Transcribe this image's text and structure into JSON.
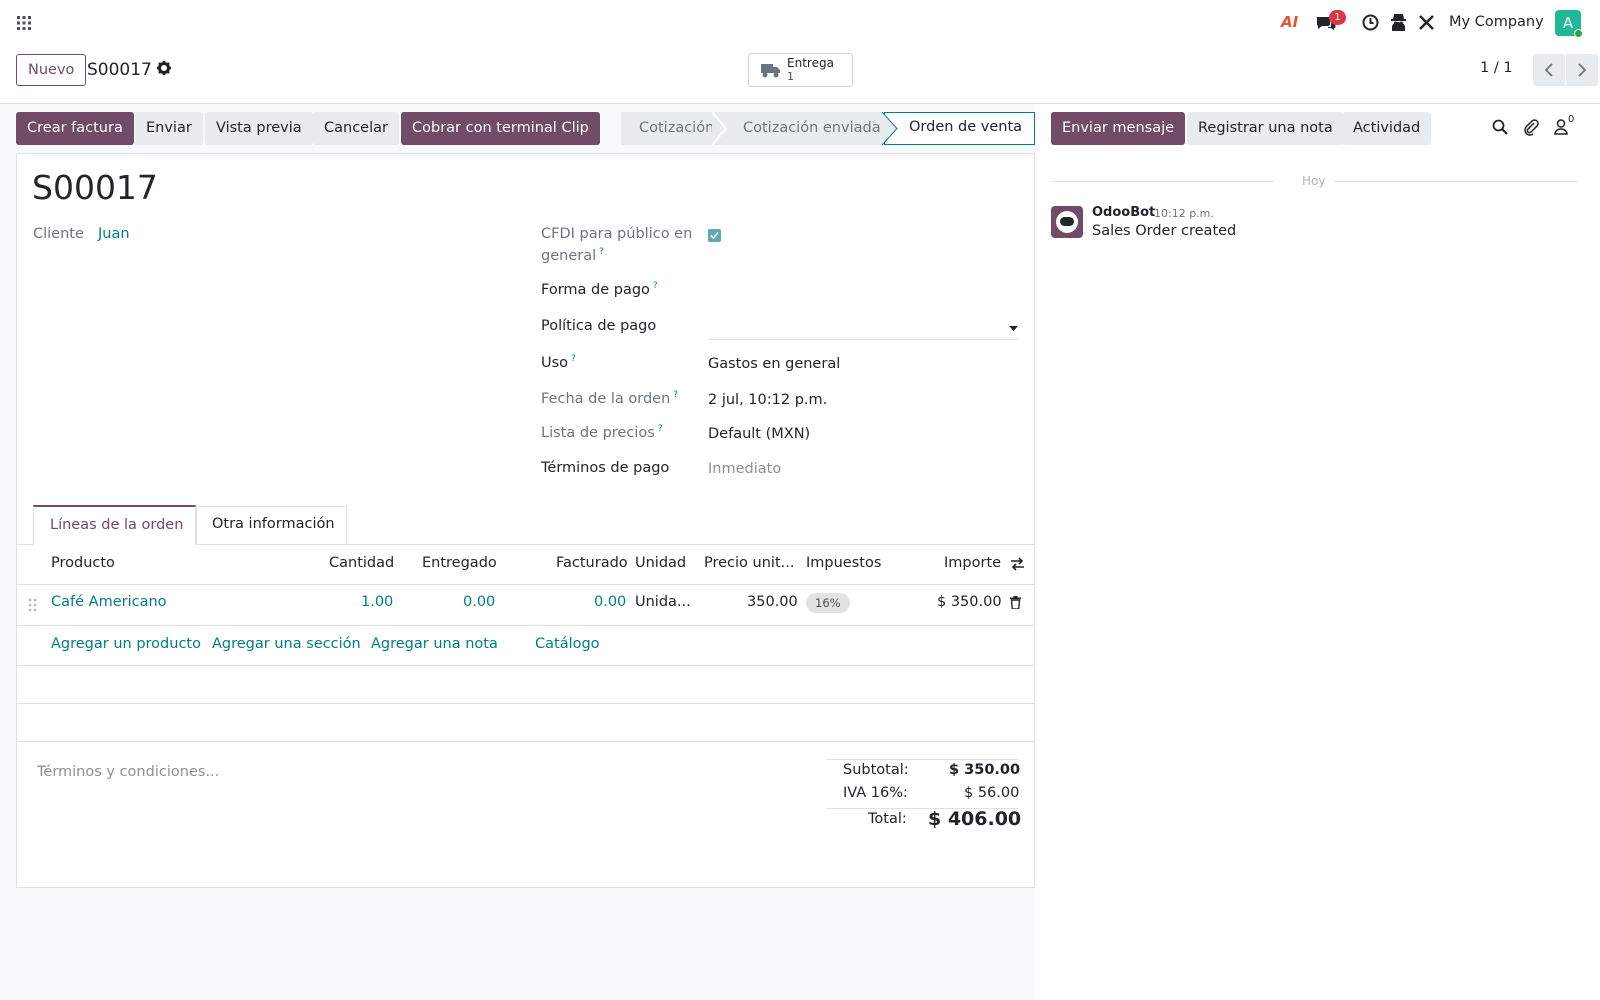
{
  "topbar": {
    "company": "My Company",
    "notif_count": "1",
    "avatar_letter": "A",
    "ai_label": "AI"
  },
  "control": {
    "new_label": "Nuevo",
    "record": "S00017",
    "delivery_label": "Entrega",
    "delivery_count": "1",
    "pager": "1 / 1"
  },
  "actions": {
    "create_invoice": "Crear factura",
    "send": "Enviar",
    "preview": "Vista previa",
    "cancel": "Cancelar",
    "clip": "Cobrar con terminal Clip"
  },
  "stages": [
    "Cotización",
    "Cotización enviada",
    "Orden de venta"
  ],
  "chatter": {
    "send_message": "Enviar mensaje",
    "log_note": "Registrar una nota",
    "activity": "Actividad",
    "followers_count": "0",
    "today": "Hoy",
    "author": "OdooBot",
    "time": "10:12 p.m.",
    "message": "Sales Order created"
  },
  "form": {
    "title": "S00017",
    "customer_label": "Cliente",
    "customer_value": "Juan",
    "cfdi_label_1": "CFDI para público en",
    "cfdi_label_2": "general",
    "forma_pago_label": "Forma de pago",
    "politica_label": "Política de pago",
    "uso_label": "Uso",
    "uso_value": "Gastos en general",
    "fecha_label": "Fecha de la orden",
    "fecha_value": "2 jul, 10:12 p.m.",
    "lista_label": "Lista de precios",
    "lista_value": "Default (MXN)",
    "terminos_label": "Términos de pago",
    "terminos_placeholder": "Inmediato",
    "help": "?"
  },
  "tabs": [
    "Líneas de la orden",
    "Otra información"
  ],
  "table": {
    "headers": {
      "product": "Producto",
      "qty": "Cantidad",
      "delivered": "Entregado",
      "invoiced": "Facturado",
      "unit": "Unidad",
      "price": "Precio unit...",
      "taxes": "Impuestos",
      "amount": "Importe"
    },
    "rows": [
      {
        "product": "Café Americano",
        "qty": "1.00",
        "delivered": "0.00",
        "invoiced": "0.00",
        "unit": "Unida...",
        "price": "350.00",
        "tax": "16%",
        "amount": "$ 350.00"
      }
    ],
    "add_product": "Agregar un producto",
    "add_section": "Agregar una sección",
    "add_note": "Agregar una nota",
    "catalog": "Catálogo"
  },
  "footer": {
    "terms_placeholder": "Términos y condiciones...",
    "subtotal_label": "Subtotal:",
    "subtotal_value": "$ 350.00",
    "iva_label": "IVA 16%:",
    "iva_value": "$ 56.00",
    "total_label": "Total:",
    "total_value": "$ 406.00"
  },
  "colors": {
    "primary": "#714b67",
    "link": "#017e84",
    "badge": "#dc3545",
    "avatar": "#21b799"
  }
}
